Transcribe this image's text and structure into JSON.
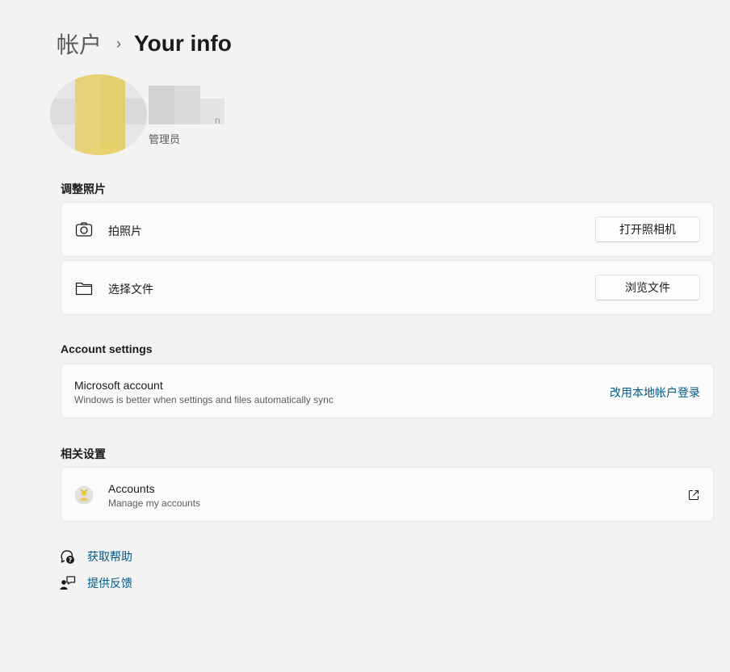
{
  "breadcrumb": {
    "parent": "帐户",
    "separator": "›",
    "current": "Your info"
  },
  "profile": {
    "role": "管理员",
    "name_suffix": "n"
  },
  "adjust_photo": {
    "section_title": "调整照片",
    "take_photo": {
      "label": "拍照片",
      "button": "打开照相机"
    },
    "choose_file": {
      "label": "选择文件",
      "button": "浏览文件"
    }
  },
  "account_settings": {
    "section_title": "Account settings",
    "microsoft_account": {
      "title": "Microsoft account",
      "subtitle": "Windows is better when settings and files automatically sync",
      "action": "改用本地帐户登录"
    }
  },
  "related": {
    "section_title": "相关设置",
    "accounts": {
      "title": "Accounts",
      "subtitle": "Manage my accounts"
    }
  },
  "help": {
    "get_help": "获取帮助",
    "give_feedback": "提供反馈"
  },
  "colors": {
    "link": "#005a8c",
    "background": "#f3f3f3",
    "card": "#fbfbfb"
  },
  "icons": [
    "camera-icon",
    "folder-icon",
    "accounts-icon",
    "external-link-icon",
    "help-icon",
    "feedback-icon"
  ]
}
